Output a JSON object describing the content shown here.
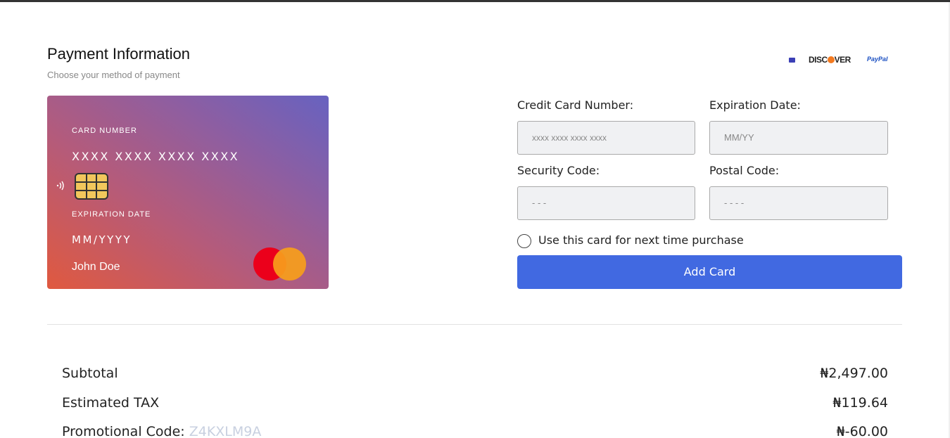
{
  "header": {
    "title": "Payment Information",
    "subtitle": "Choose your method of payment"
  },
  "brand_logos": {
    "discover": "DISC",
    "discover_tail": "VER",
    "paypal": "PayPal"
  },
  "card_preview": {
    "number_label": "CARD NUMBER",
    "number_value": "XXXX XXXX XXXX XXXX",
    "expiration_label": "EXPIRATION DATE",
    "expiration_value": "MM/YYYY",
    "holder_name": "John Doe",
    "gradient_colors": [
      "#e0593f",
      "#b45b7b",
      "#8f5ea0",
      "#6762c0"
    ]
  },
  "form": {
    "card_number_label": "Credit Card Number:",
    "card_number_placeholder": "xxxx xxxx xxxx xxxx",
    "expiration_label": "Expiration Date:",
    "expiration_placeholder": "MM/YY",
    "security_label": "Security Code:",
    "security_placeholder": "- - -",
    "postal_label": "Postal Code:",
    "postal_placeholder": "- - - -",
    "save_card_label": "Use this card for next time purchase",
    "save_card_checked": false,
    "add_card_label": "Add Card",
    "accent_color": "#4169e1"
  },
  "summary": {
    "subtotal_label": "Subtotal",
    "subtotal_value": "₦2,497.00",
    "tax_label": "Estimated TAX",
    "tax_value": "₦119.64",
    "promo_label": "Promotional Code: ",
    "promo_code": "Z4KXLM9A",
    "promo_value": "₦-60.00"
  }
}
